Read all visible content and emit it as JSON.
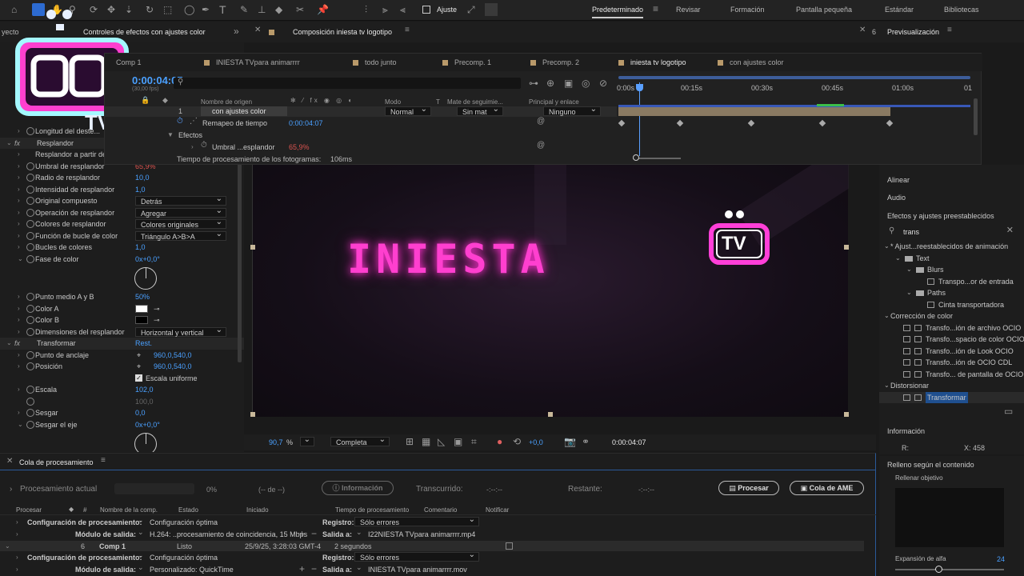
{
  "toolbar": {
    "ajuste_label": "Ajuste",
    "workspaces": [
      "Predeterminado",
      "Revisar",
      "Formación",
      "Pantalla pequeña",
      "Estándar",
      "Bibliotecas"
    ]
  },
  "panels": {
    "project_tab": "yecto",
    "effects_tab": "Controles de efectos con ajustes color",
    "comp_tab": "Composición iniesta tv logotipo",
    "preview_tab": "Previsualización",
    "preview_num": "6"
  },
  "comp_tabs": [
    "Comp 1",
    "INIESTA TVpara animarrrr",
    "todo junto",
    "Precomp. 1",
    "Precomp. 2",
    "iniesta tv logotipo",
    "con ajustes color"
  ],
  "timeline": {
    "timecode": "0:00:04:07",
    "fps": "(30,00 fps)",
    "ruler": [
      "0:00s",
      "00:15s",
      "00:30s",
      "00:45s",
      "01:00s",
      "01"
    ],
    "col_source": "Nombre de origen",
    "col_mode": "Modo",
    "col_t": "T",
    "col_matte": "Mate de seguimie...",
    "col_parent": "Principal y enlace",
    "layer_num": "1",
    "layer_name": "con ajustes color",
    "layer_mode": "Normal",
    "layer_matte": "Sin mat",
    "layer_parent": "Ninguno",
    "remap_label": "Remapeo de tiempo",
    "remap_value": "0:00:04:07",
    "effects_label": "Efectos",
    "threshold_label": "Umbral ...esplandor",
    "threshold_value": "65,9%",
    "render_time": "Tiempo de procesamiento de los fotogramas:",
    "render_ms": "106ms"
  },
  "effects": {
    "rows": [
      {
        "name": "Longitud del deste...",
        "value": ""
      },
      {
        "name": "Resplandor",
        "value": ""
      },
      {
        "name": "Resplandor a partir de",
        "value": ""
      },
      {
        "name": "Umbral de resplandor",
        "value": "65,9%"
      },
      {
        "name": "Radio de resplandor",
        "value": "10,0"
      },
      {
        "name": "Intensidad de resplandor",
        "value": "1,0"
      },
      {
        "name": "Original compuesto",
        "value": "Detrás"
      },
      {
        "name": "Operación de resplandor",
        "value": "Agregar"
      },
      {
        "name": "Colores de resplandor",
        "value": "Colores originales"
      },
      {
        "name": "Función de bucle de color",
        "value": "Triángulo A>B>A"
      },
      {
        "name": "Bucles de colores",
        "value": "1,0"
      },
      {
        "name": "Fase de color",
        "value": "0x+0,0°"
      },
      {
        "name": "Punto medio A y B",
        "value": "50%"
      },
      {
        "name": "Color A",
        "value": ""
      },
      {
        "name": "Color B",
        "value": ""
      },
      {
        "name": "Dimensiones del resplandor",
        "value": "Horizontal y vertical"
      },
      {
        "name": "Transformar",
        "value": "Rest."
      },
      {
        "name": "Punto de anclaje",
        "value": "960,0,540,0"
      },
      {
        "name": "Posición",
        "value": "960,0,540,0"
      },
      {
        "name": "Escala uniforme",
        "value": ""
      },
      {
        "name": "Escala",
        "value": "102,0"
      },
      {
        "name": "",
        "value": "100,0"
      },
      {
        "name": "Sesgar",
        "value": "0,0"
      },
      {
        "name": "Sesgar el eje",
        "value": "0x+0,0°"
      }
    ]
  },
  "viewer": {
    "logo_text": "INIESTA",
    "tv_text": "TV",
    "zoom": "90,7",
    "zoom_unit": "%",
    "quality": "Completa",
    "exposure": "+0,0",
    "timecode": "0:00:04:07"
  },
  "right_panel": {
    "align": "Alinear",
    "audio": "Audio",
    "effects_presets": "Efectos y ajustes preestablecidos",
    "search": "trans",
    "tree": [
      "* Ajust...reestablecidos de animación",
      "Text",
      "Blurs",
      "Transpo...or de entrada",
      "Paths",
      "Cinta transportadora",
      "Corrección de color",
      "Transfo...ión de archivo OCIO",
      "Transfo...spacio de color OCIO",
      "Transfo...ión de Look OCIO",
      "Transfo...ión de OCIO CDL",
      "Transfo... de pantalla de OCIO",
      "Distorsionar",
      "Transformar"
    ],
    "info_title": "Información",
    "info_r": "R:",
    "info_x": "X: 458",
    "fill_title": "Relleno según el contenido",
    "fill_sub": "Rellenar objetivo",
    "alpha_label": "Expansión de alfa",
    "alpha_value": "24"
  },
  "render_queue": {
    "title": "Cola de procesamiento",
    "current": "Procesamiento actual",
    "percent": "0%",
    "of": "(-- de --)",
    "info_btn": "Información",
    "elapsed": "Transcurrido:",
    "elapsed_val": "-:--:--",
    "remaining": "Restante:",
    "remaining_val": "-:--:--",
    "render_btn": "Procesar",
    "ame_btn": "Cola de AME",
    "headers": [
      "Procesar",
      "#",
      "Nombre de la comp.",
      "Estado",
      "Iniciado",
      "Tiempo de procesamiento",
      "Comentario",
      "Notificar"
    ],
    "settings_label": "Configuración de procesamiento:",
    "settings_val": "Configuración óptima",
    "registro_label": "Registro:",
    "registro_val": "Sólo errores",
    "module_label": "Módulo de salida:",
    "module1_val": "H.264: ..procesamiento de coincidencia, 15 Mbps",
    "output_label": "Salida a:",
    "output1_val": "I22NIESTA TVpara animarrrr.mp4",
    "item_num": "6",
    "item_name": "Comp 1",
    "item_status": "Listo",
    "item_started": "25/9/25, 3:28:03 GMT-4",
    "item_time": "2 segundos",
    "settings2_val": "Configuración óptima",
    "registro2_val": "Sólo errores",
    "module2_val": "Personalizado: QuickTime",
    "output2_val": "INIESTA TVpara animarrrr.mov"
  }
}
